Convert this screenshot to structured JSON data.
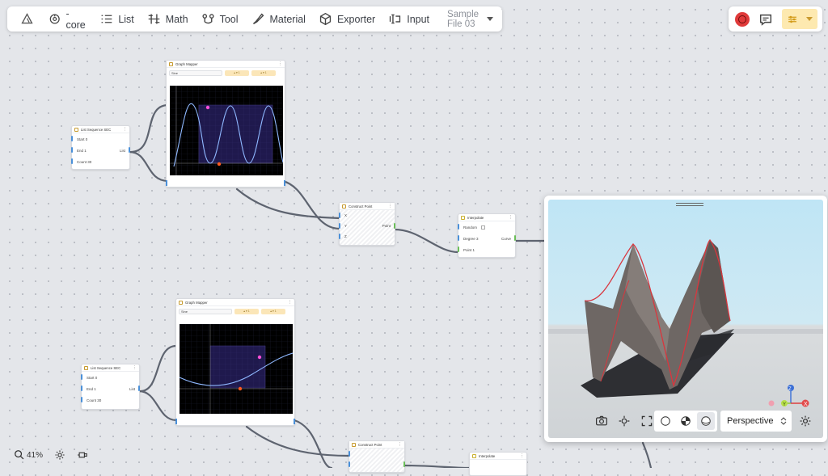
{
  "toolbar": {
    "items": [
      {
        "label": "-core",
        "icon": "core-icon"
      },
      {
        "label": "List",
        "icon": "list-icon"
      },
      {
        "label": "Math",
        "icon": "math-icon"
      },
      {
        "label": "Tool",
        "icon": "tool-icon"
      },
      {
        "label": "Material",
        "icon": "material-icon"
      },
      {
        "label": "Exporter",
        "icon": "exporter-icon"
      },
      {
        "label": "Input",
        "icon": "input-icon"
      }
    ],
    "file_name": "Sample File 03"
  },
  "nodes": {
    "seq1": {
      "title": "List Sequence SEC",
      "start": "Start  0",
      "end": "End  1",
      "count": "Count  30",
      "out": "List"
    },
    "gm1": {
      "title": "Graph Mapper",
      "select": "Sine",
      "btn1": "▴ ▾  1",
      "btn2": "▴ ▾  1"
    },
    "cp1": {
      "title": "Construct Point",
      "x": "X",
      "y": "Y",
      "z": "Z",
      "out": "Point"
    },
    "interp1": {
      "title": "Interpolate",
      "a": "Random",
      "b": "Degree  3",
      "c": "Point 1",
      "out": "Curve"
    },
    "seq2": {
      "title": "List Sequence SEC",
      "start": "Start  0",
      "end": "End  1",
      "count": "Count  30",
      "out": "List"
    },
    "gm2": {
      "title": "Graph Mapper",
      "select": "Sine",
      "btn1": "▴ ▾  1",
      "btn2": "▴ ▾  1"
    },
    "cp2": {
      "title": "Construct Point"
    },
    "interp2": {
      "title": "Interpolate"
    }
  },
  "viewport": {
    "projection": "Perspective",
    "axis_labels": {
      "x": "X",
      "y": "Y",
      "z": "Z"
    }
  },
  "zoom": {
    "value": "41%"
  },
  "colors": {
    "accent": "#fde9b0",
    "record": "#e03a3a",
    "wire": "#5e6470",
    "port": "#4a90d9"
  }
}
